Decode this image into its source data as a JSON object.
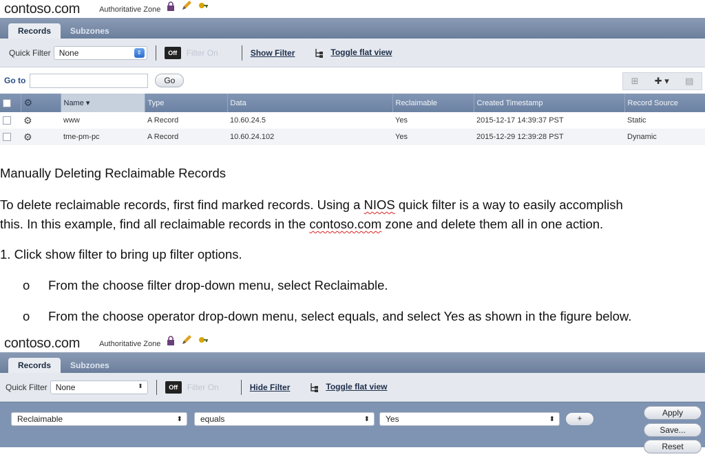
{
  "screenshot1": {
    "zone_name": "contoso.com",
    "zone_type": "Authoritative Zone",
    "tabs": [
      "Records",
      "Subzones"
    ],
    "quick_filter_label": "Quick Filter",
    "quick_filter_value": "None",
    "off_label": "Off",
    "filter_on_label": "Filter On",
    "show_filter_label": "Show Filter",
    "toggle_flat_view_label": "Toggle flat view",
    "goto_label": "Go to",
    "goto_button": "Go",
    "columns": [
      "Name",
      "Type",
      "Data",
      "Reclaimable",
      "Created Timestamp",
      "Record Source"
    ],
    "rows": [
      {
        "name": "www",
        "type": "A Record",
        "data": "10.60.24.5",
        "reclaimable": "Yes",
        "created": "2015-12-17 14:39:37 PST",
        "source": "Static"
      },
      {
        "name": "tme-pm-pc",
        "type": "A Record",
        "data": "10.60.24.102",
        "reclaimable": "Yes",
        "created": "2015-12-29 12:39:28 PST",
        "source": "Dynamic"
      }
    ]
  },
  "document": {
    "heading": "Manually Deleting Reclaimable Records",
    "para1_line1_a": "To delete reclaimable records, first find marked records. Using a ",
    "para1_nios": "NIOS",
    "para1_line1_b": " quick filter is a way to easily accomplish",
    "para1_line2_a": "this. In this example, find all reclaimable records in the ",
    "para1_zone": "contoso.com",
    "para1_line2_b": " zone and delete them all in one action.",
    "step1": "1. Click show filter to bring up filter options.",
    "bullet_symbol": "o",
    "bullet1": "From the choose filter drop-down menu, select Reclaimable.",
    "bullet2": "From the choose operator drop-down menu, select equals, and select Yes as shown in the figure below."
  },
  "screenshot2": {
    "zone_name": "contoso.com",
    "zone_type": "Authoritative Zone",
    "tabs": [
      "Records",
      "Subzones"
    ],
    "quick_filter_label": "Quick Filter",
    "quick_filter_value": "None",
    "off_label": "Off",
    "filter_on_label": "Filter On",
    "hide_filter_label": "Hide Filter",
    "toggle_flat_view_label": "Toggle flat view",
    "filter_field": "Reclaimable",
    "filter_operator": "equals",
    "filter_value": "Yes",
    "add_button": "+",
    "apply_button": "Apply",
    "save_button": "Save...",
    "reset_button": "Reset"
  }
}
